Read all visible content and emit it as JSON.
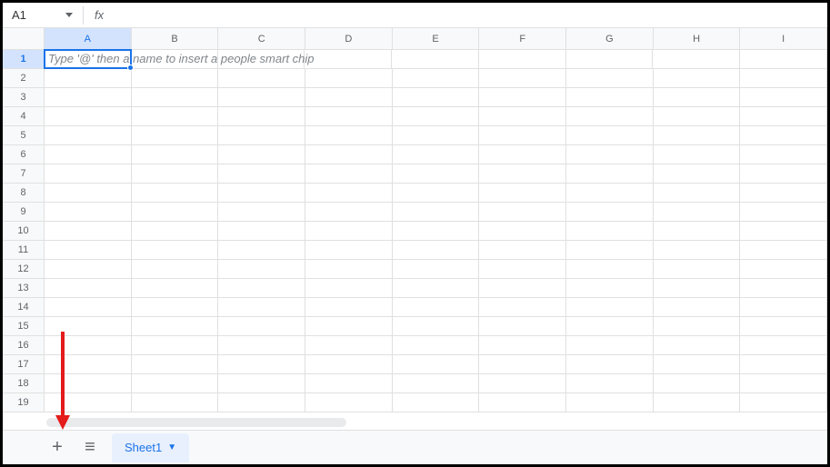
{
  "nameBox": {
    "value": "A1"
  },
  "formulaBar": {
    "fxLabel": "fx",
    "value": ""
  },
  "columns": [
    "A",
    "B",
    "C",
    "D",
    "E",
    "F",
    "G",
    "H",
    "I"
  ],
  "rows": [
    1,
    2,
    3,
    4,
    5,
    6,
    7,
    8,
    9,
    10,
    11,
    12,
    13,
    14,
    15,
    16,
    17,
    18,
    19
  ],
  "activeCell": {
    "col": "A",
    "row": 1,
    "placeholder": "Type '@' then a name to insert a people smart chip"
  },
  "sheets": {
    "addLabel": "+",
    "menuLabel": "≡",
    "tabs": [
      {
        "name": "Sheet1",
        "active": true
      }
    ]
  }
}
